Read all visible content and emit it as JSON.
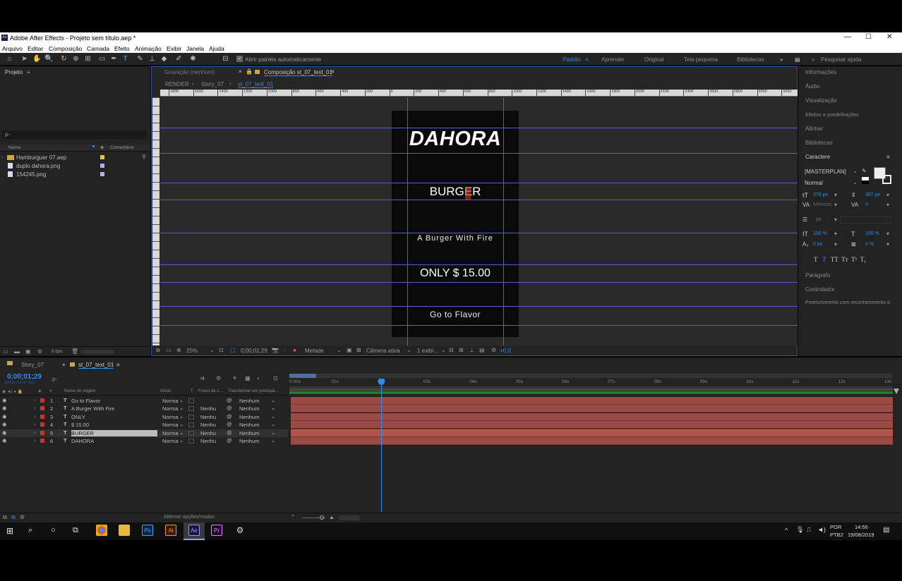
{
  "app": {
    "title": "Adobe After Effects - Projeto sem título.aep *",
    "logo": "Ae"
  },
  "menu": [
    "Arquivo",
    "Editar",
    "Composição",
    "Camada",
    "Efeito",
    "Animação",
    "Exibir",
    "Janela",
    "Ajuda"
  ],
  "toolbar": {
    "auto_open_label": "Abrir painéis automaticamente",
    "workspaces": [
      "Padrão",
      "Aprender",
      "Original",
      "Tela pequena",
      "Bibliotecas"
    ],
    "search_placeholder": "Pesquisar ajuda"
  },
  "project": {
    "title": "Projeto",
    "search_placeholder": "ρ-",
    "col_name": "Nome",
    "col_comment": "Comentário",
    "items": [
      {
        "name": "Hamburguer 07.aep",
        "type": "folder",
        "color": "#e8c842"
      },
      {
        "name": "duplo dahora.png",
        "type": "image",
        "color": "#b6b0e8"
      },
      {
        "name": "154245.png",
        "type": "image",
        "color": "#b6b0e8"
      }
    ],
    "bpc": "8 bpc"
  },
  "viewer": {
    "tab_footage": "Gravação  (nenhum)",
    "tab_comp": "Composição st_07_text_01",
    "crumbs": [
      "RENDER",
      "Story_07",
      "st_07_text_01"
    ],
    "ruler_labels": [
      "1800",
      "1600",
      "1400",
      "1200",
      "1000",
      "800",
      "600",
      "400",
      "200",
      "0",
      "200",
      "400",
      "600",
      "800",
      "1000",
      "1200",
      "1400",
      "1600",
      "1800",
      "2000",
      "2200",
      "2400",
      "2600",
      "2800",
      "3000",
      "3200"
    ],
    "comp_text": {
      "dahora": "DAHORA",
      "burger": "BURGER",
      "tagline": "A Burger With Fire",
      "price": "ONLY $ 15.00",
      "cta": "Go to Flavor"
    },
    "zoom": "25%",
    "timecode": "0;00;01;29",
    "resolution": "Metade",
    "camera": "Câmera ativa",
    "views": "1 exibi...",
    "exposure": "+0,0"
  },
  "right_panel": {
    "items_top": [
      "Informações",
      "Áudio",
      "Visualização",
      "Efeitos e predefinições",
      "Alinhar",
      "Bibliotecas",
      "Caractere"
    ],
    "font": "[MASTERPLAN]",
    "style": "Normal",
    "font_size": "370 px",
    "leading": "387 px",
    "kerning": "Métricas",
    "tracking": "0",
    "stroke": "- px",
    "vscale": "100 %",
    "hscale": "100 %",
    "baseline": "0 px",
    "tsume": "0 %",
    "items_bottom": [
      "Parágrafo",
      "Controlador",
      "Preenchimento com reconhecimento d"
    ]
  },
  "timeline": {
    "tabs": [
      "Story_07",
      "st_07_text_01"
    ],
    "timecode": "0;00;01;29",
    "fps": "00059 (29,97 fps)",
    "headers": {
      "num": "#",
      "source": "Nome de origem",
      "mode": "Modo",
      "t": "T",
      "trkmat": "Fosco de c...",
      "parent": "Transformar em principal..."
    },
    "layers": [
      {
        "num": "1",
        "name": "Go to Flavor",
        "mode": "Norma",
        "trk": "",
        "parent": "Nenhum"
      },
      {
        "num": "2",
        "name": "A Burger With Fire",
        "mode": "Norma",
        "trk": "Nenhu",
        "parent": "Nenhum"
      },
      {
        "num": "3",
        "name": "ONLY",
        "mode": "Norma",
        "trk": "Nenhu",
        "parent": "Nenhum"
      },
      {
        "num": "4",
        "name": "$ 15.00",
        "mode": "Norma",
        "trk": "Nenhu",
        "parent": "Nenhum"
      },
      {
        "num": "5",
        "name": "BURGER",
        "mode": "Norma",
        "trk": "Nenhu",
        "parent": "Nenhum"
      },
      {
        "num": "6",
        "name": "DAHORA",
        "mode": "Norma",
        "trk": "Nenhu",
        "parent": "Nenhum"
      }
    ],
    "time_labels": [
      "0:00s",
      "01s",
      "02s",
      "03s",
      "04s",
      "05s",
      "06s",
      "07s",
      "08s",
      "09s",
      "10s",
      "11s",
      "12s",
      "13s"
    ],
    "toggle_label": "Alternar opções/modos"
  },
  "taskbar": {
    "lang": "POR",
    "layout": "PTB2",
    "time": "14:56",
    "date": "19/08/2019",
    "apps": [
      "Ps",
      "Ai",
      "Ae",
      "Pr"
    ]
  },
  "colors": {
    "accent": "#2d8ceb",
    "layer_bar": "#9c4a46",
    "guide": "#5a5ec8",
    "label_red": "#c0392b"
  }
}
